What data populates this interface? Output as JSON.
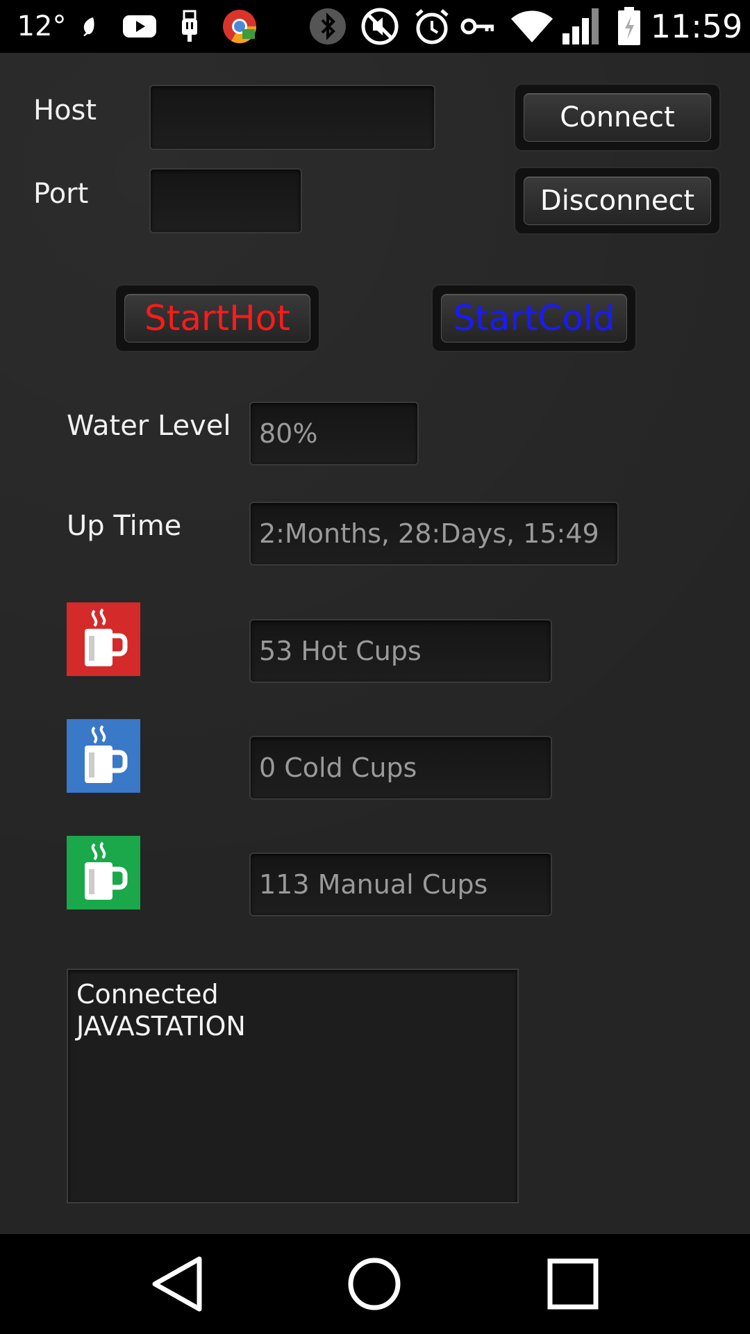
{
  "status_bar": {
    "temperature": "12°",
    "time": "11:59",
    "icons": [
      "leaf-icon",
      "youtube-icon",
      "usb-icon",
      "chrome-icon",
      "bluetooth-icon",
      "mute-icon",
      "alarm-icon",
      "vpn-key-icon",
      "wifi-icon",
      "signal-icon",
      "battery-icon"
    ]
  },
  "connection": {
    "host_label": "Host",
    "host_value": "",
    "port_label": "Port",
    "port_value": "",
    "connect_label": "Connect",
    "disconnect_label": "Disconnect"
  },
  "controls": {
    "start_hot_label": "StartHot",
    "start_hot_color": "#ff1a1a",
    "start_cold_label": "StartCold",
    "start_cold_color": "#1a1aff"
  },
  "stats": {
    "water_level_label": "Water Level",
    "water_level_value": "80%",
    "uptime_label": "Up Time",
    "uptime_value": "2:Months, 28:Days, 15:49",
    "hot_cups": "53 Hot Cups",
    "cold_cups": "0 Cold Cups",
    "manual_cups": "113 Manual Cups",
    "hot_color": "#d42a2a",
    "cold_color": "#3a78c8",
    "manual_color": "#1aa84a"
  },
  "log": {
    "line1": "Connected",
    "line2": "JAVASTATION"
  }
}
